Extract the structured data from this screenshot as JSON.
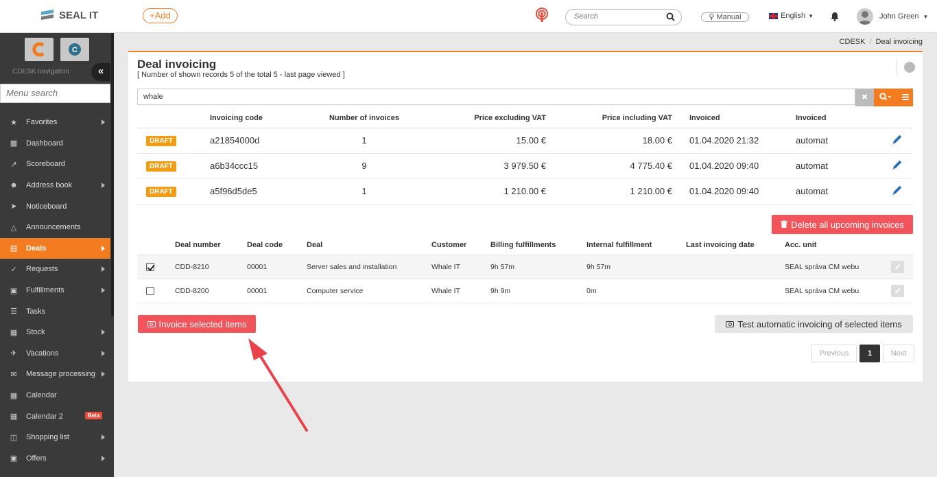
{
  "header": {
    "logo_text": "SEAL IT",
    "add_label": "+Add",
    "search_placeholder": "Search",
    "manual_label": "Manual",
    "language": "English",
    "user_name": "John Green"
  },
  "sidebar": {
    "nav_label": "CDESK navigation",
    "menu_search_placeholder": "Menu search",
    "items": [
      {
        "label": "Favorites",
        "icon": "star-icon",
        "arrow": true
      },
      {
        "label": "Dashboard",
        "icon": "bar-chart-icon",
        "arrow": false
      },
      {
        "label": "Scoreboard",
        "icon": "line-chart-icon",
        "arrow": false
      },
      {
        "label": "Address book",
        "icon": "user-icon",
        "arrow": true
      },
      {
        "label": "Noticeboard",
        "icon": "paper-plane-icon",
        "arrow": false
      },
      {
        "label": "Announcements",
        "icon": "megaphone-icon",
        "arrow": false
      },
      {
        "label": "Deals",
        "icon": "credit-card-icon",
        "arrow": true,
        "active": true
      },
      {
        "label": "Requests",
        "icon": "check-circle-icon",
        "arrow": true
      },
      {
        "label": "Fulfillments",
        "icon": "cube-icon",
        "arrow": true
      },
      {
        "label": "Tasks",
        "icon": "list-icon",
        "arrow": false
      },
      {
        "label": "Stock",
        "icon": "archive-icon",
        "arrow": true
      },
      {
        "label": "Vacations",
        "icon": "plane-icon",
        "arrow": true
      },
      {
        "label": "Message processing",
        "icon": "envelope-icon",
        "arrow": true
      },
      {
        "label": "Calendar",
        "icon": "calendar-icon",
        "arrow": false
      },
      {
        "label": "Calendar 2",
        "icon": "calendar-icon",
        "arrow": false,
        "badge": "Beta"
      },
      {
        "label": "Shopping list",
        "icon": "cart-icon",
        "arrow": true
      },
      {
        "label": "Offers",
        "icon": "gift-icon",
        "arrow": true
      }
    ]
  },
  "breadcrumb": {
    "root": "CDESK",
    "current": "Deal invoicing"
  },
  "page": {
    "title": "Deal invoicing",
    "subtitle": "[ Number of shown records 5 of the total 5 - last page viewed ]",
    "filter_value": "whale"
  },
  "invoices_table": {
    "headers": [
      "Invoicing code",
      "Number of invoices",
      "Price excluding VAT",
      "Price including VAT",
      "Invoiced",
      "Invoiced"
    ],
    "rows": [
      {
        "status": "DRAFT",
        "code": "a21854000d",
        "count": "1",
        "price_ex": "15.00 €",
        "price_inc": "18.00 €",
        "invoiced_date": "01.04.2020 21:32",
        "invoiced_by": "automat"
      },
      {
        "status": "DRAFT",
        "code": "a6b34ccc15",
        "count": "9",
        "price_ex": "3 979.50 €",
        "price_inc": "4 775.40 €",
        "invoiced_date": "01.04.2020 09:40",
        "invoiced_by": "automat"
      },
      {
        "status": "DRAFT",
        "code": "a5f96d5de5",
        "count": "1",
        "price_ex": "1 210.00 €",
        "price_inc": "1 210.00 €",
        "invoiced_date": "01.04.2020 09:40",
        "invoiced_by": "automat"
      }
    ]
  },
  "delete_all_label": "Delete all upcoming invoices",
  "deals_table": {
    "headers": [
      "Deal number",
      "Deal code",
      "Deal",
      "Customer",
      "Billing fulfillments",
      "Internal fulfillment",
      "Last invoicing date",
      "Acc. unit"
    ],
    "rows": [
      {
        "checked": true,
        "number": "CDD-8210",
        "code": "00001",
        "deal": "Server sales and installation",
        "customer": "Whale IT",
        "billing": "9h 57m",
        "internal": "9h 57m",
        "last_date": "",
        "unit": "SEAL správa CM webu"
      },
      {
        "checked": false,
        "number": "CDD-8200",
        "code": "00001",
        "deal": "Computer service",
        "customer": "Whale IT",
        "billing": "9h 9m",
        "internal": "0m",
        "last_date": "",
        "unit": "SEAL správa CM webu"
      }
    ]
  },
  "invoice_selected_label": "Invoice selected items",
  "test_invoicing_label": "Test automatic invoicing of selected items",
  "pager": {
    "prev": "Previous",
    "current": "1",
    "next": "Next"
  },
  "colors": {
    "accent": "#f47c20",
    "danger": "#f1545a",
    "draft": "#f39c12",
    "sidebar": "#3a3a3a"
  }
}
